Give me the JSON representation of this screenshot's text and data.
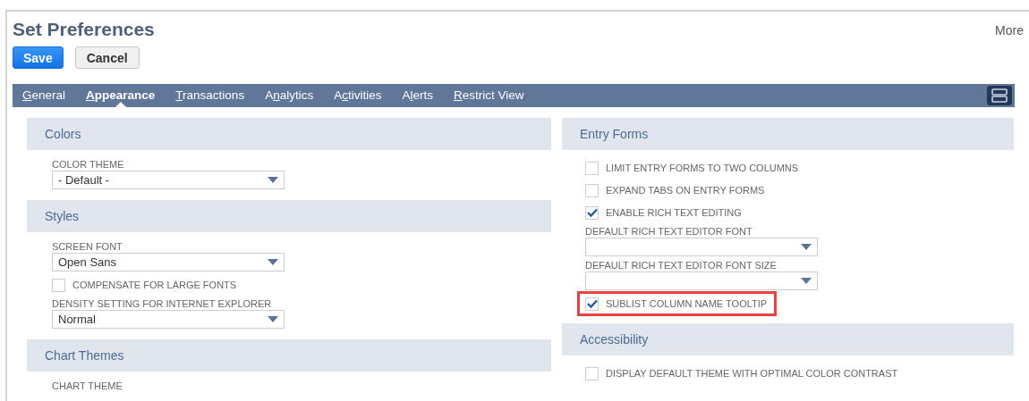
{
  "page": {
    "title": "Set Preferences",
    "more_link": "More"
  },
  "buttons": [
    {
      "label": "Save",
      "kind": "primary"
    },
    {
      "label": "Cancel",
      "kind": "secondary"
    }
  ],
  "tabs": [
    {
      "label": {
        "key": "G",
        "post": "eneral"
      },
      "selected": false
    },
    {
      "label": {
        "key": "A",
        "post": "ppearance"
      },
      "selected": true
    },
    {
      "label": {
        "key": "T",
        "post": "ransactions"
      },
      "selected": false
    },
    {
      "label": {
        "pre": "A",
        "key": "n",
        "post": "alytics"
      },
      "selected": false
    },
    {
      "label": {
        "pre": "A",
        "key": "c",
        "post": "tivities"
      },
      "selected": false
    },
    {
      "label": {
        "pre": "A",
        "key": "l",
        "post": "erts"
      },
      "selected": false
    },
    {
      "label": {
        "key": "R",
        "post": "estrict View"
      },
      "selected": false
    }
  ],
  "columns": [
    {
      "sections": [
        {
          "title": "Colors",
          "items": [
            {
              "kind": "select",
              "label": "COLOR THEME",
              "value": "- Default -"
            }
          ]
        },
        {
          "title": "Styles",
          "items": [
            {
              "kind": "select",
              "label": "SCREEN FONT",
              "value": "Open Sans"
            },
            {
              "kind": "checkbox",
              "label": "COMPENSATE FOR LARGE FONTS",
              "checked": false
            },
            {
              "kind": "select",
              "label": "DENSITY SETTING FOR INTERNET EXPLORER",
              "value": "Normal"
            }
          ]
        },
        {
          "title": "Chart Themes",
          "items": [
            {
              "kind": "label",
              "label": "CHART THEME"
            }
          ]
        }
      ]
    },
    {
      "sections": [
        {
          "title": "Entry Forms",
          "items": [
            {
              "kind": "checkbox",
              "label": "LIMIT ENTRY FORMS TO TWO COLUMNS",
              "checked": false
            },
            {
              "kind": "checkbox",
              "label": "EXPAND TABS ON ENTRY FORMS",
              "checked": false
            },
            {
              "kind": "checkbox",
              "label": "ENABLE RICH TEXT EDITING",
              "checked": true
            },
            {
              "kind": "select",
              "label": "DEFAULT RICH TEXT EDITOR FONT"
            },
            {
              "kind": "select",
              "label": "DEFAULT RICH TEXT EDITOR FONT SIZE"
            },
            {
              "kind": "checkbox",
              "label": "SUBLIST COLUMN NAME TOOLTIP",
              "checked": true,
              "highlighted": true
            }
          ]
        },
        {
          "title": "Accessibility",
          "items": [
            {
              "kind": "checkbox",
              "label": "DISPLAY DEFAULT THEME WITH OPTIMAL COLOR CONTRAST",
              "checked": false
            }
          ]
        }
      ]
    }
  ]
}
